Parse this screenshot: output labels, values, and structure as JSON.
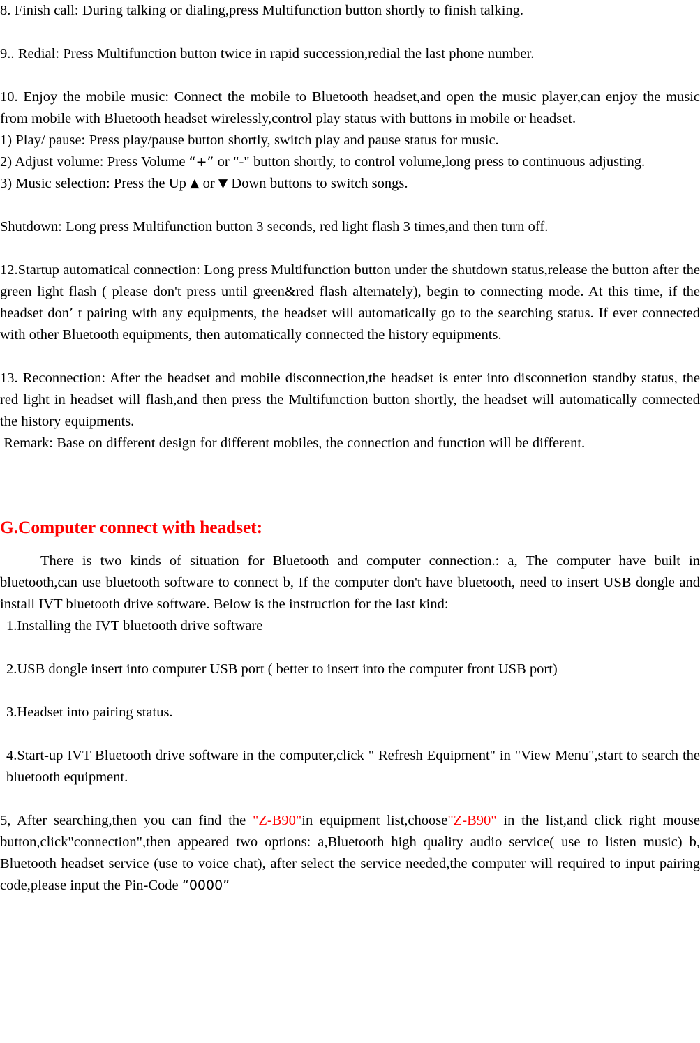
{
  "document": {
    "type": "bluetooth-headset-user-manual-page",
    "text_color": "#000000",
    "accent_color": "#FF0000",
    "background_color": "#FFFFFF"
  },
  "paragraphs": {
    "item8": "8. Finish call: During talking or dialing,press Multifunction button shortly to finish talking.",
    "item9": "9.. Redial: Press Multifunction button twice in rapid succession,redial the last phone number.",
    "item10": "10. Enjoy the mobile music: Connect the mobile to Bluetooth headset,and open the music player,can enjoy the music from mobile with Bluetooth headset wirelessly,control play status with buttons in mobile or headset.",
    "sub1": "1) Play/ pause: Press play/pause button shortly, switch play and pause status for music.",
    "sub2_a": "2) Adjust volume: Press Volume ",
    "sub2_quoted_plus": "“+”",
    "sub2_b": " or \"-\" button shortly, to control volume,long press to continuous adjusting.",
    "sub3_a": "3) Music selection: Press the Up ",
    "sub3_up_arrow": "▲",
    "sub3_b": " or ",
    "sub3_down_arrow": "▼",
    "sub3_c": " Down buttons to switch songs.",
    "shutdown": "Shutdown: Long press Multifunction button 3 seconds, red light flash 3 times,and then turn off.",
    "item12_a": "12.Startup automatical connection: Long press Multifunction button under the shutdown status,release the button after the green light flash ( please don't press until green&red flash alternately), begin to connecting mode. At this time, if the headset don",
    "item12_apos": "’",
    "item12_b": " t pairing with any equipments, the headset will automatically go to the searching status. If ever connected with other Bluetooth equipments, then automatically connected the history equipments.",
    "item13": "13. Reconnection: After the headset and mobile disconnection,the headset is enter into disconnetion standby status, the red light in headset will flash,and then press the Multifunction button shortly, the headset will automatically connected the history equipments.",
    "remark": "Remark: Base on different design for different mobiles, the connection and function will be different."
  },
  "section_heading": {
    "label": "G.Computer connect with headset:",
    "color": "#FF0000"
  },
  "computer_section": {
    "intro": "There is two kinds of situation for Bluetooth and computer connection.: a, The computer have built in bluetooth,can use bluetooth software to connect   b, If the computer don't have bluetooth, need to insert USB dongle and install IVT bluetooth drive software. Below is the instruction for the last kind:",
    "steps": [
      "1.Installing the IVT bluetooth drive software",
      "2.USB dongle insert into computer USB port ( better to insert into the computer front USB port)",
      "3.Headset into pairing status.",
      "4.Start-up IVT Bluetooth drive software in the computer,click \" Refresh Equipment\" in \"View Menu\",start to search the bluetooth equipment."
    ],
    "step5": {
      "part_a": "5, After searching,then you can find the ",
      "device_name_1": "\"Z-B90\"",
      "part_b": "in equipment list,choose",
      "device_name_2": "\"Z-B90\"",
      "part_c": " in the list,and click right mouse button,click\"connection\",then appeared two options: a,Bluetooth high quality audio service( use to listen music) b, Bluetooth headset service (use to voice chat), after select the service needed,the computer will required to input pairing code,please input the Pin-Code ",
      "pin_code": "“0000”"
    }
  }
}
